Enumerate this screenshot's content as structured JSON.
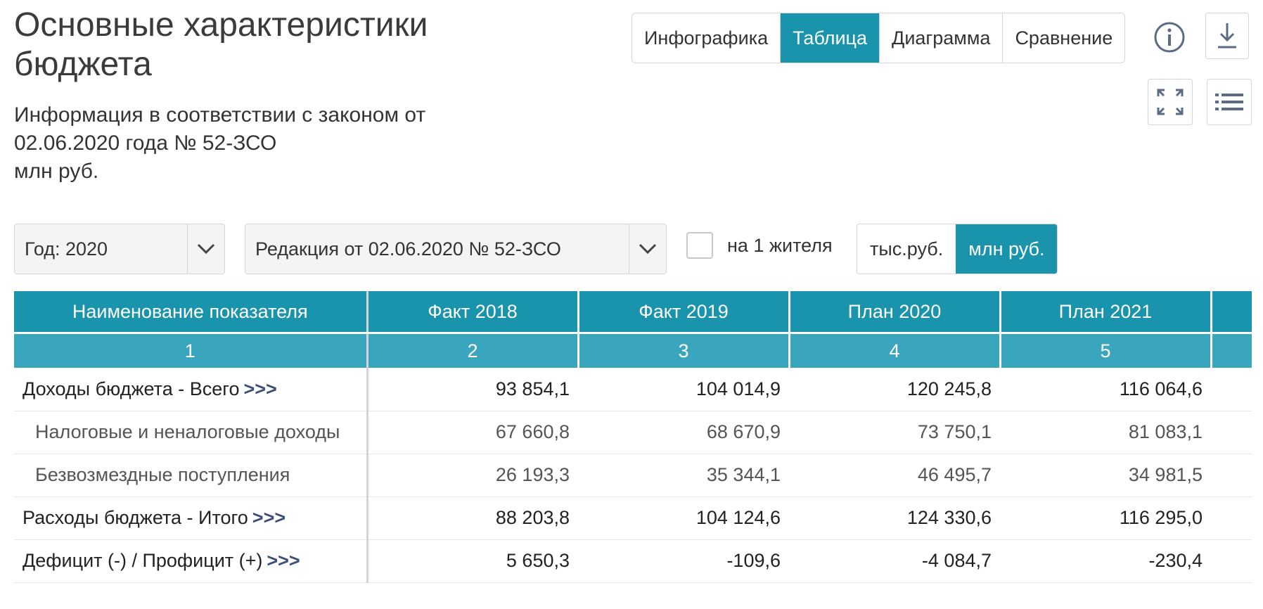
{
  "header": {
    "title_line1": "Основные характеристики",
    "title_line2": "бюджета",
    "info_line1": "Информация в соответствии с законом от",
    "info_line2": "02.06.2020 года № 52-ЗСО",
    "units_note": "млн руб."
  },
  "view_tabs": [
    {
      "label": "Инфографика",
      "active": false
    },
    {
      "label": "Таблица",
      "active": true
    },
    {
      "label": "Диаграмма",
      "active": false
    },
    {
      "label": "Сравнение",
      "active": false
    }
  ],
  "icons": {
    "info": "info-icon",
    "download": "download-icon",
    "fullscreen": "expand-icon",
    "menu": "list-menu-icon"
  },
  "filters": {
    "year_label": "Год: 2020",
    "edition_label": "Редакция от 02.06.2020 № 52-ЗСО",
    "per_capita_label": "на 1 жителя",
    "per_capita_checked": false
  },
  "unit_switch": [
    {
      "label": "тыс.руб.",
      "active": false
    },
    {
      "label": "млн руб.",
      "active": true
    }
  ],
  "table": {
    "headers": [
      "Наименование показателя",
      "Факт 2018",
      "Факт 2019",
      "План 2020",
      "План 2021"
    ],
    "column_numbers": [
      "1",
      "2",
      "3",
      "4",
      "5"
    ],
    "drill_label": ">>>",
    "rows": [
      {
        "name": "Доходы бюджета - Всего",
        "bold": true,
        "drill": true,
        "values": [
          "93 854,1",
          "104 014,9",
          "120 245,8",
          "116 064,6"
        ]
      },
      {
        "name": "Налоговые и неналоговые доходы",
        "bold": false,
        "drill": false,
        "values": [
          "67 660,8",
          "68 670,9",
          "73 750,1",
          "81 083,1"
        ]
      },
      {
        "name": "Безвозмездные поступления",
        "bold": false,
        "drill": false,
        "values": [
          "26 193,3",
          "35 344,1",
          "46 495,7",
          "34 981,5"
        ]
      },
      {
        "name": "Расходы бюджета - Итого",
        "bold": true,
        "drill": true,
        "values": [
          "88 203,8",
          "104 124,6",
          "124 330,6",
          "116 295,0"
        ]
      },
      {
        "name": "Дефицит (-) / Профицит (+)",
        "bold": true,
        "drill": true,
        "values": [
          "5 650,3",
          "-109,6",
          "-4 084,7",
          "-230,4"
        ]
      }
    ]
  },
  "colors": {
    "accent": "#1a93ad",
    "accent_light": "#3aa6bd",
    "drill_link": "#3b4f78"
  }
}
